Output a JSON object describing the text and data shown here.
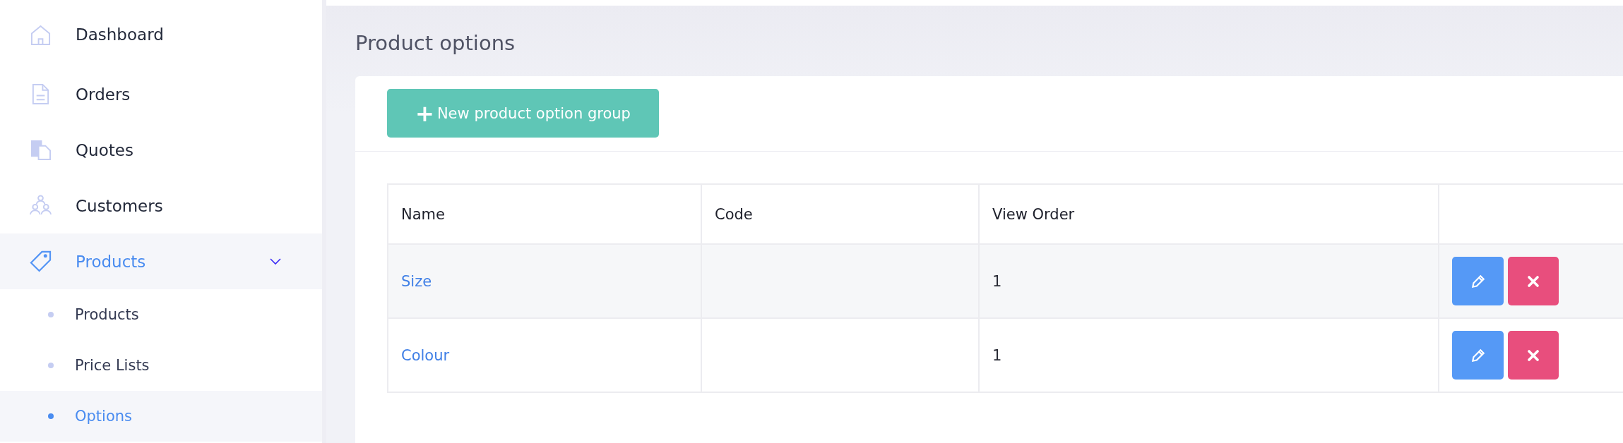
{
  "sidebar": {
    "items": [
      {
        "label": "Dashboard",
        "selected": false
      },
      {
        "label": "Orders",
        "selected": false
      },
      {
        "label": "Quotes",
        "selected": false
      },
      {
        "label": "Customers",
        "selected": false
      },
      {
        "label": "Products",
        "selected": true,
        "expanded": true,
        "children": [
          {
            "label": "Products",
            "selected": false
          },
          {
            "label": "Price Lists",
            "selected": false
          },
          {
            "label": "Options",
            "selected": true
          }
        ]
      }
    ]
  },
  "page": {
    "title": "Product options",
    "new_button": {
      "icon": "+",
      "label": "New product option group"
    }
  },
  "table": {
    "columns": [
      "Name",
      "Code",
      "View Order",
      ""
    ],
    "rows": [
      {
        "name": "Size",
        "view_order": "1"
      },
      {
        "name": "Colour",
        "view_order": "1"
      }
    ]
  }
}
